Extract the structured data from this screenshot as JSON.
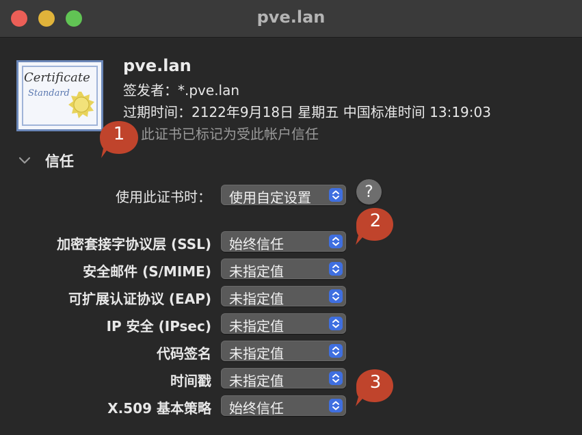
{
  "window": {
    "title": "pve.lan"
  },
  "certificate": {
    "icon_text_line1": "Certificate",
    "icon_text_line2": "Standard",
    "name": "pve.lan",
    "issuer": "签发者：*.pve.lan",
    "expiry": "过期时间：2122年9月18日 星期五 中国标准时间 13:19:03",
    "trusted_note": "此证书已标记为受此帐户信任"
  },
  "trust": {
    "heading": "信任",
    "when_using": {
      "label": "使用此证书时：",
      "value": "使用自定设置"
    },
    "help_symbol": "?",
    "rows": [
      {
        "label": "加密套接字协议层 (SSL)",
        "value": "始终信任"
      },
      {
        "label": "安全邮件 (S/MIME)",
        "value": "未指定值"
      },
      {
        "label": "可扩展认证协议 (EAP)",
        "value": "未指定值"
      },
      {
        "label": "IP 安全 (IPsec)",
        "value": "未指定值"
      },
      {
        "label": "代码签名",
        "value": "未指定值"
      },
      {
        "label": "时间戳",
        "value": "未指定值"
      },
      {
        "label": "X.509 基本策略",
        "value": "始终信任"
      }
    ]
  },
  "annotations": [
    "1",
    "2",
    "3"
  ],
  "colors": {
    "accent": "#3f6fe0",
    "badge": "#c0442c",
    "background": "#282828",
    "titlebar": "#3a3a3a"
  }
}
